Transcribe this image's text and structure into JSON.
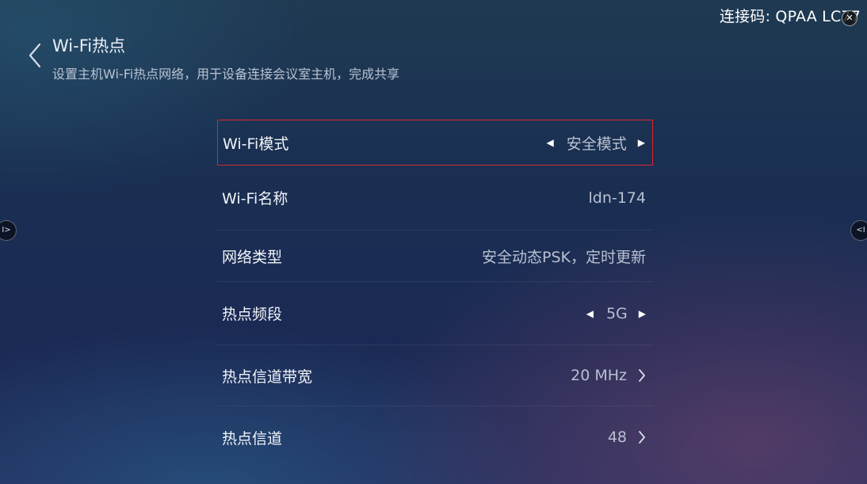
{
  "header": {
    "connection_code": "连接码: QPAA LC77",
    "title": "Wi-Fi热点",
    "subtitle": "设置主机Wi-Fi热点网络，用于设备连接会议室主机，完成共享"
  },
  "settings": [
    {
      "label": "Wi-Fi模式",
      "value": "安全模式",
      "control": "selector"
    },
    {
      "label": "Wi-Fi名称",
      "value": "ldn-174",
      "control": "text"
    },
    {
      "label": "网络类型",
      "value": "安全动态PSK，定时更新",
      "control": "text"
    },
    {
      "label": "热点频段",
      "value": "5G",
      "control": "selector"
    },
    {
      "label": "热点信道带宽",
      "value": "20 MHz",
      "control": "chevron"
    },
    {
      "label": "热点信道",
      "value": "48",
      "control": "chevron"
    }
  ],
  "icons": {
    "back": "chevron-left-icon",
    "close": "close-icon",
    "left_handle": "expand-left-icon",
    "right_handle": "expand-right-icon"
  },
  "colors": {
    "focus_border": "#d9262f",
    "value_text": "#b8c1d1"
  }
}
